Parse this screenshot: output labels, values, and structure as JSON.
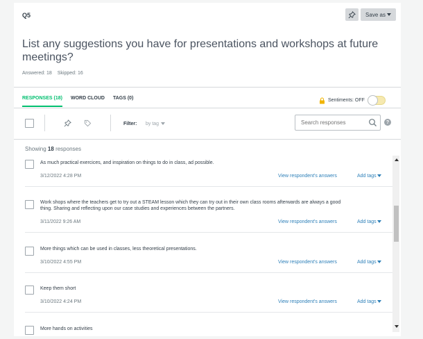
{
  "question": {
    "number": "Q5",
    "title": "List any suggestions you have for presentations and workshops at future meetings?",
    "answered": "Answered: 18",
    "skipped": "Skipped: 16"
  },
  "header": {
    "save_label": "Save as"
  },
  "tabs": [
    {
      "label": "RESPONSES (18)",
      "active": true
    },
    {
      "label": "WORD CLOUD",
      "active": false
    },
    {
      "label": "TAGS (0)",
      "active": false
    }
  ],
  "sentiments": {
    "label": "Sentiments: OFF"
  },
  "toolbar": {
    "filter_label": "Filter:",
    "filter_value": "by tag",
    "search_placeholder": "Search responses"
  },
  "showing": {
    "prefix": "Showing",
    "count": "18",
    "suffix": "responses"
  },
  "row_actions": {
    "view": "View respondent's answers",
    "tags": "Add tags"
  },
  "responses": [
    {
      "text": "As much practical exercices, and inspiration on things to do in class, ad possible.",
      "date": "3/12/2022 4:28 PM"
    },
    {
      "text": "Work shops where the teachers get to try out a STEAM lesson which they can try out in their own class rooms afterwards are always a good thing. Sharing and reflecting upon our case studies and experiences between the partners.",
      "date": "3/11/2022 9:26 AM"
    },
    {
      "text": "More things which can be used in classes, less theoretical presentations.",
      "date": "3/10/2022 4:55 PM"
    },
    {
      "text": "Keep them short",
      "date": "3/10/2022 4:24 PM"
    },
    {
      "text": "More hands on activities",
      "date": ""
    }
  ],
  "colors": {
    "accent": "#00bf6f",
    "link": "#2c7fb8",
    "lock": "#f0b400"
  }
}
